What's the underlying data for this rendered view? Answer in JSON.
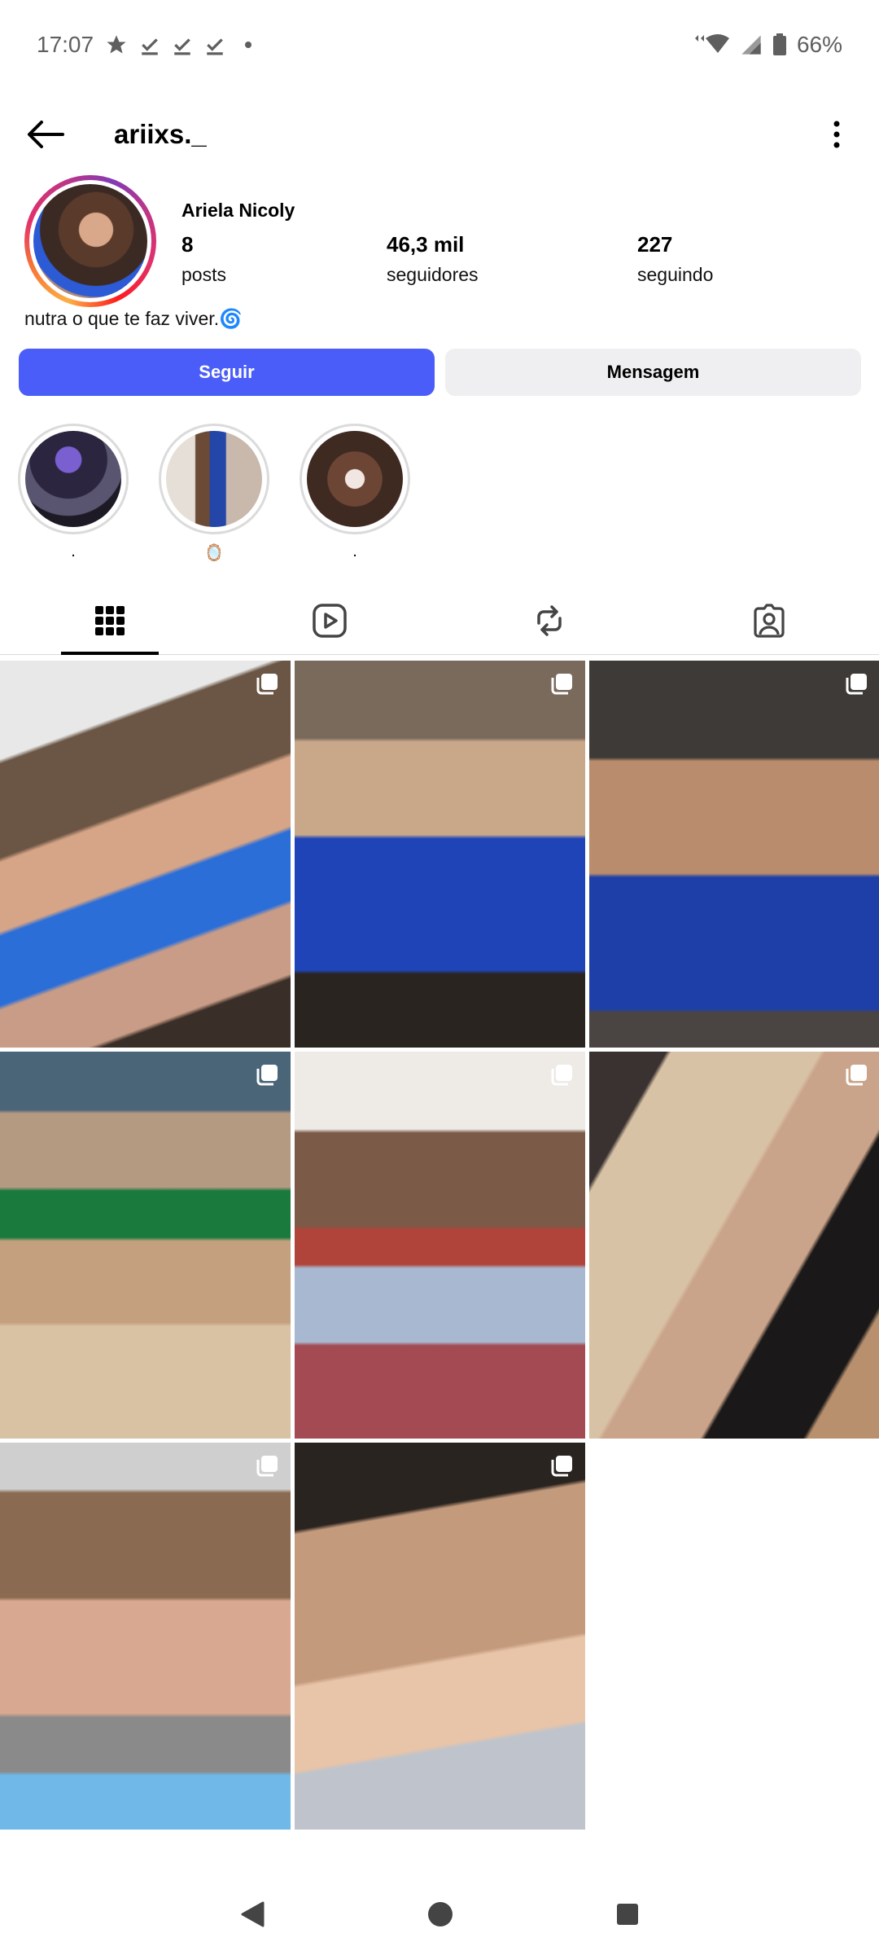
{
  "status_bar": {
    "time": "17:07",
    "battery": "66%",
    "icons": [
      "star-icon",
      "check-icon",
      "check-icon",
      "check-icon",
      "wifi-icon",
      "signal-icon",
      "battery-icon"
    ]
  },
  "header": {
    "username": "ariixs._",
    "back_icon": "arrow-left-icon",
    "more_icon": "more-vertical-icon"
  },
  "profile": {
    "display_name": "Ariela Nicoly",
    "posts_count": "8",
    "posts_label": "posts",
    "followers_count": "46,3 mil",
    "followers_label": "seguidores",
    "following_count": "227",
    "following_label": "seguindo",
    "bio": "nutra o que te faz viver.",
    "bio_emoji": "🌀"
  },
  "buttons": {
    "follow": "Seguir",
    "message": "Mensagem",
    "follow_color": "#4a5df9"
  },
  "highlights": [
    {
      "label": "."
    },
    {
      "label": "🪞"
    },
    {
      "label": "."
    }
  ],
  "tabs": [
    "grid-icon",
    "reels-icon",
    "reposts-icon",
    "tagged-icon"
  ],
  "grid": {
    "posts": [
      {
        "multi": true
      },
      {
        "multi": true
      },
      {
        "multi": true
      },
      {
        "multi": true
      },
      {
        "multi": true
      },
      {
        "multi": true
      },
      {
        "multi": true
      },
      {
        "multi": true
      }
    ]
  },
  "nav_bar": [
    "back-triangle-icon",
    "home-circle-icon",
    "recents-square-icon"
  ]
}
